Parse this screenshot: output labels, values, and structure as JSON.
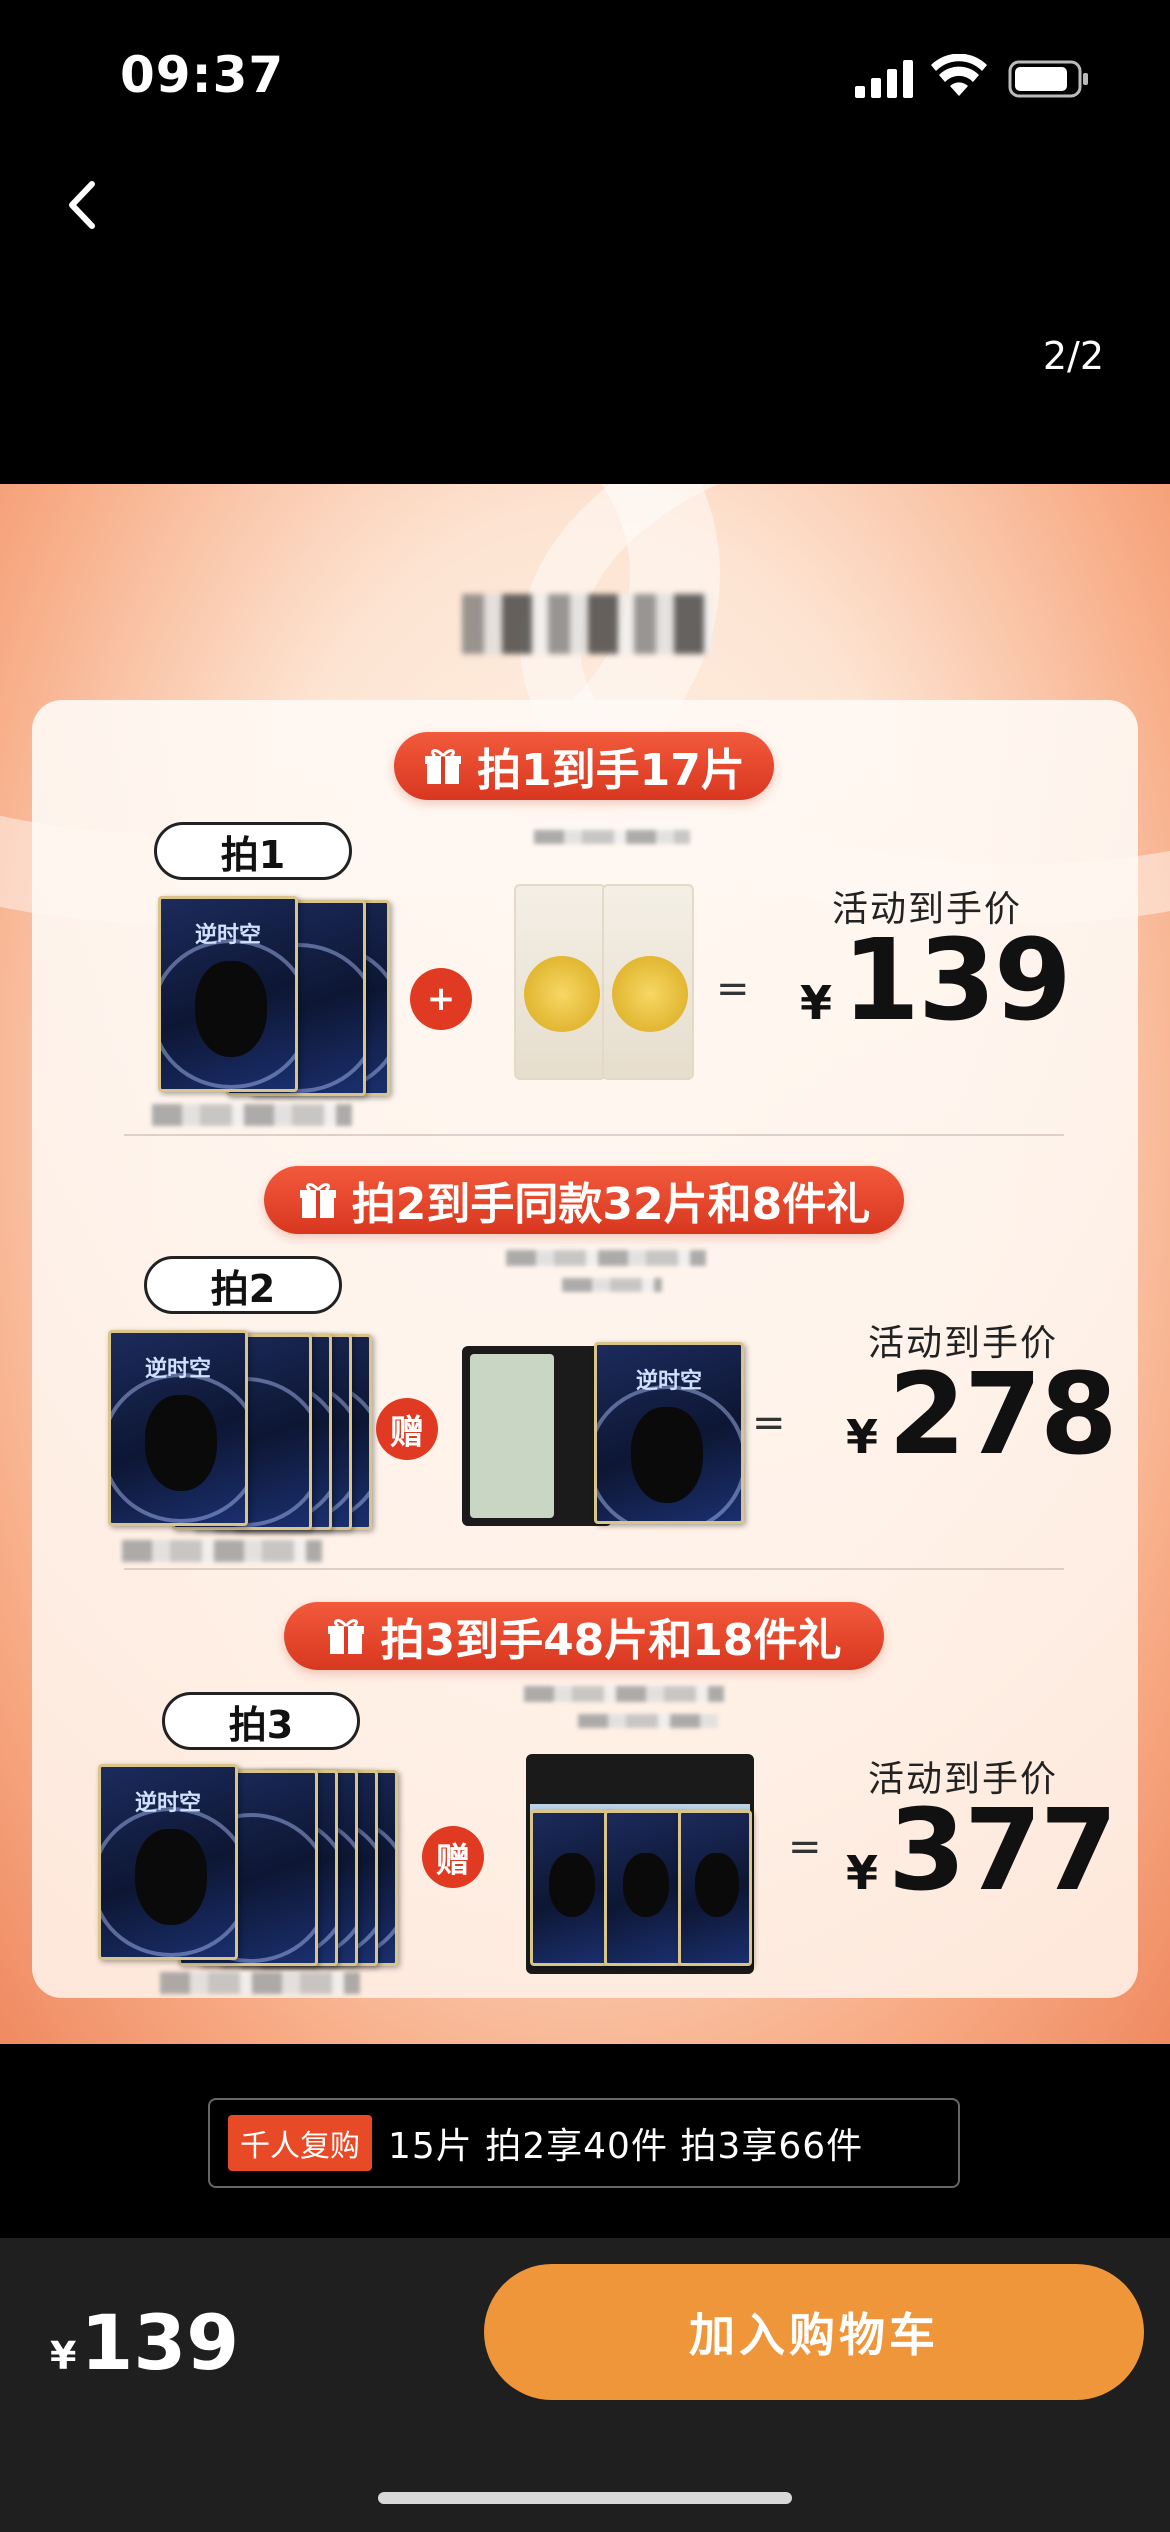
{
  "status_bar": {
    "time": "09:37"
  },
  "nav": {
    "page_counter": "2/2"
  },
  "promo": {
    "tiers": [
      {
        "ribbon": "拍1到手17片",
        "pill": "拍1",
        "connector": "+",
        "price_label": "活动到手价",
        "currency": "¥",
        "price": "139"
      },
      {
        "ribbon": "拍2到手同款32片和8件礼",
        "pill": "拍2",
        "connector": "赠",
        "price_label": "活动到手价",
        "currency": "¥",
        "price": "278"
      },
      {
        "ribbon": "拍3到手48片和18件礼",
        "pill": "拍3",
        "connector": "赠",
        "price_label": "活动到手价",
        "currency": "¥",
        "price": "377"
      }
    ],
    "equals": "=",
    "mask_brand": "逆时空",
    "colors": {
      "ribbon": "#e03a22",
      "background": "#fde4d2"
    }
  },
  "repurchase": {
    "tag": "千人复购",
    "text": "15片 拍2享40件 拍3享66件"
  },
  "bottom": {
    "currency": "¥",
    "price": "139",
    "add_to_cart": "加入购物车",
    "button_color": "#f0963a"
  }
}
